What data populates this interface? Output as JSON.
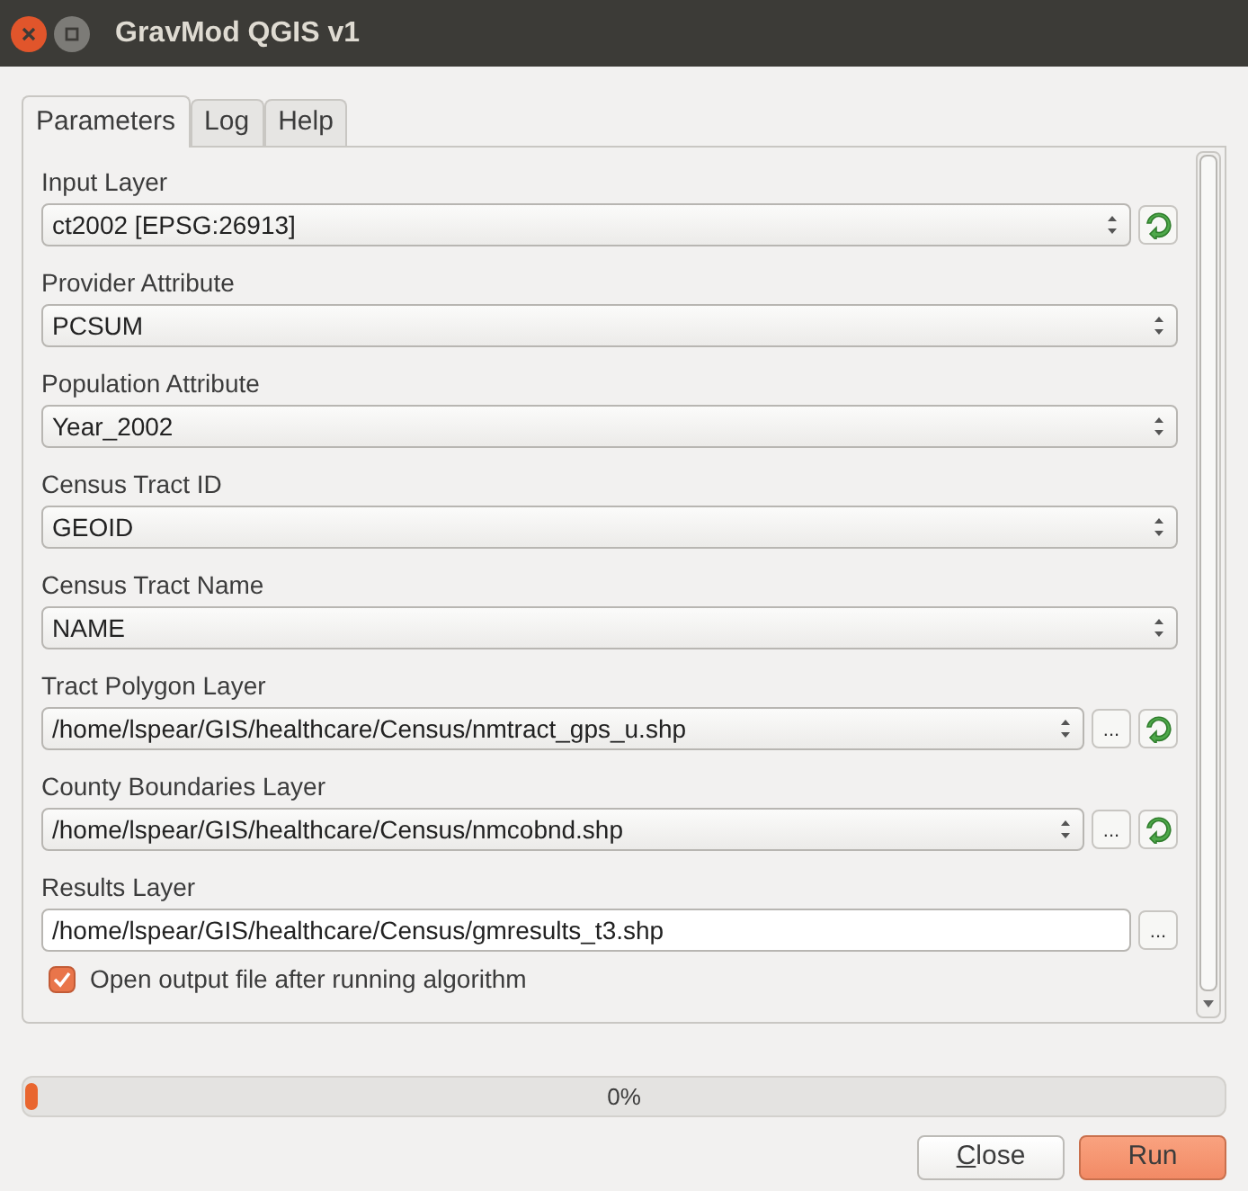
{
  "window": {
    "title": "GravMod QGIS v1"
  },
  "tabs": [
    {
      "label": "Parameters",
      "selected": true
    },
    {
      "label": "Log",
      "selected": false
    },
    {
      "label": "Help",
      "selected": false
    }
  ],
  "params": [
    {
      "label": "Input Layer",
      "kind": "combo",
      "value": "ct2002 [EPSG:26913]",
      "actions": [
        {
          "kind": "refresh"
        }
      ]
    },
    {
      "label": "Provider Attribute",
      "kind": "combo",
      "value": "PCSUM"
    },
    {
      "label": "Population Attribute",
      "kind": "combo",
      "value": "Year_2002"
    },
    {
      "label": "Census Tract ID",
      "kind": "combo",
      "value": "GEOID"
    },
    {
      "label": "Census Tract Name",
      "kind": "combo",
      "value": "NAME"
    },
    {
      "label": "Tract Polygon Layer",
      "kind": "combo",
      "value": "/home/lspear/GIS/healthcare/Census/nmtract_gps_u.shp",
      "actions": [
        {
          "kind": "browse",
          "label": "..."
        },
        {
          "kind": "refresh"
        }
      ]
    },
    {
      "label": "County Boundaries Layer",
      "kind": "combo",
      "value": "/home/lspear/GIS/healthcare/Census/nmcobnd.shp",
      "actions": [
        {
          "kind": "browse",
          "label": "..."
        },
        {
          "kind": "refresh"
        }
      ]
    },
    {
      "label": "Results Layer",
      "kind": "text",
      "value": "/home/lspear/GIS/healthcare/Census/gmresults_t3.shp",
      "actions": [
        {
          "kind": "browse",
          "label": "..."
        }
      ]
    }
  ],
  "open_output": {
    "label": "Open output file after running algorithm",
    "checked": true
  },
  "progress": {
    "level": 0.01,
    "reading": "0%"
  },
  "buttons": [
    {
      "label": "Close",
      "kind": "default"
    },
    {
      "label": "Run",
      "kind": "primary"
    }
  ]
}
